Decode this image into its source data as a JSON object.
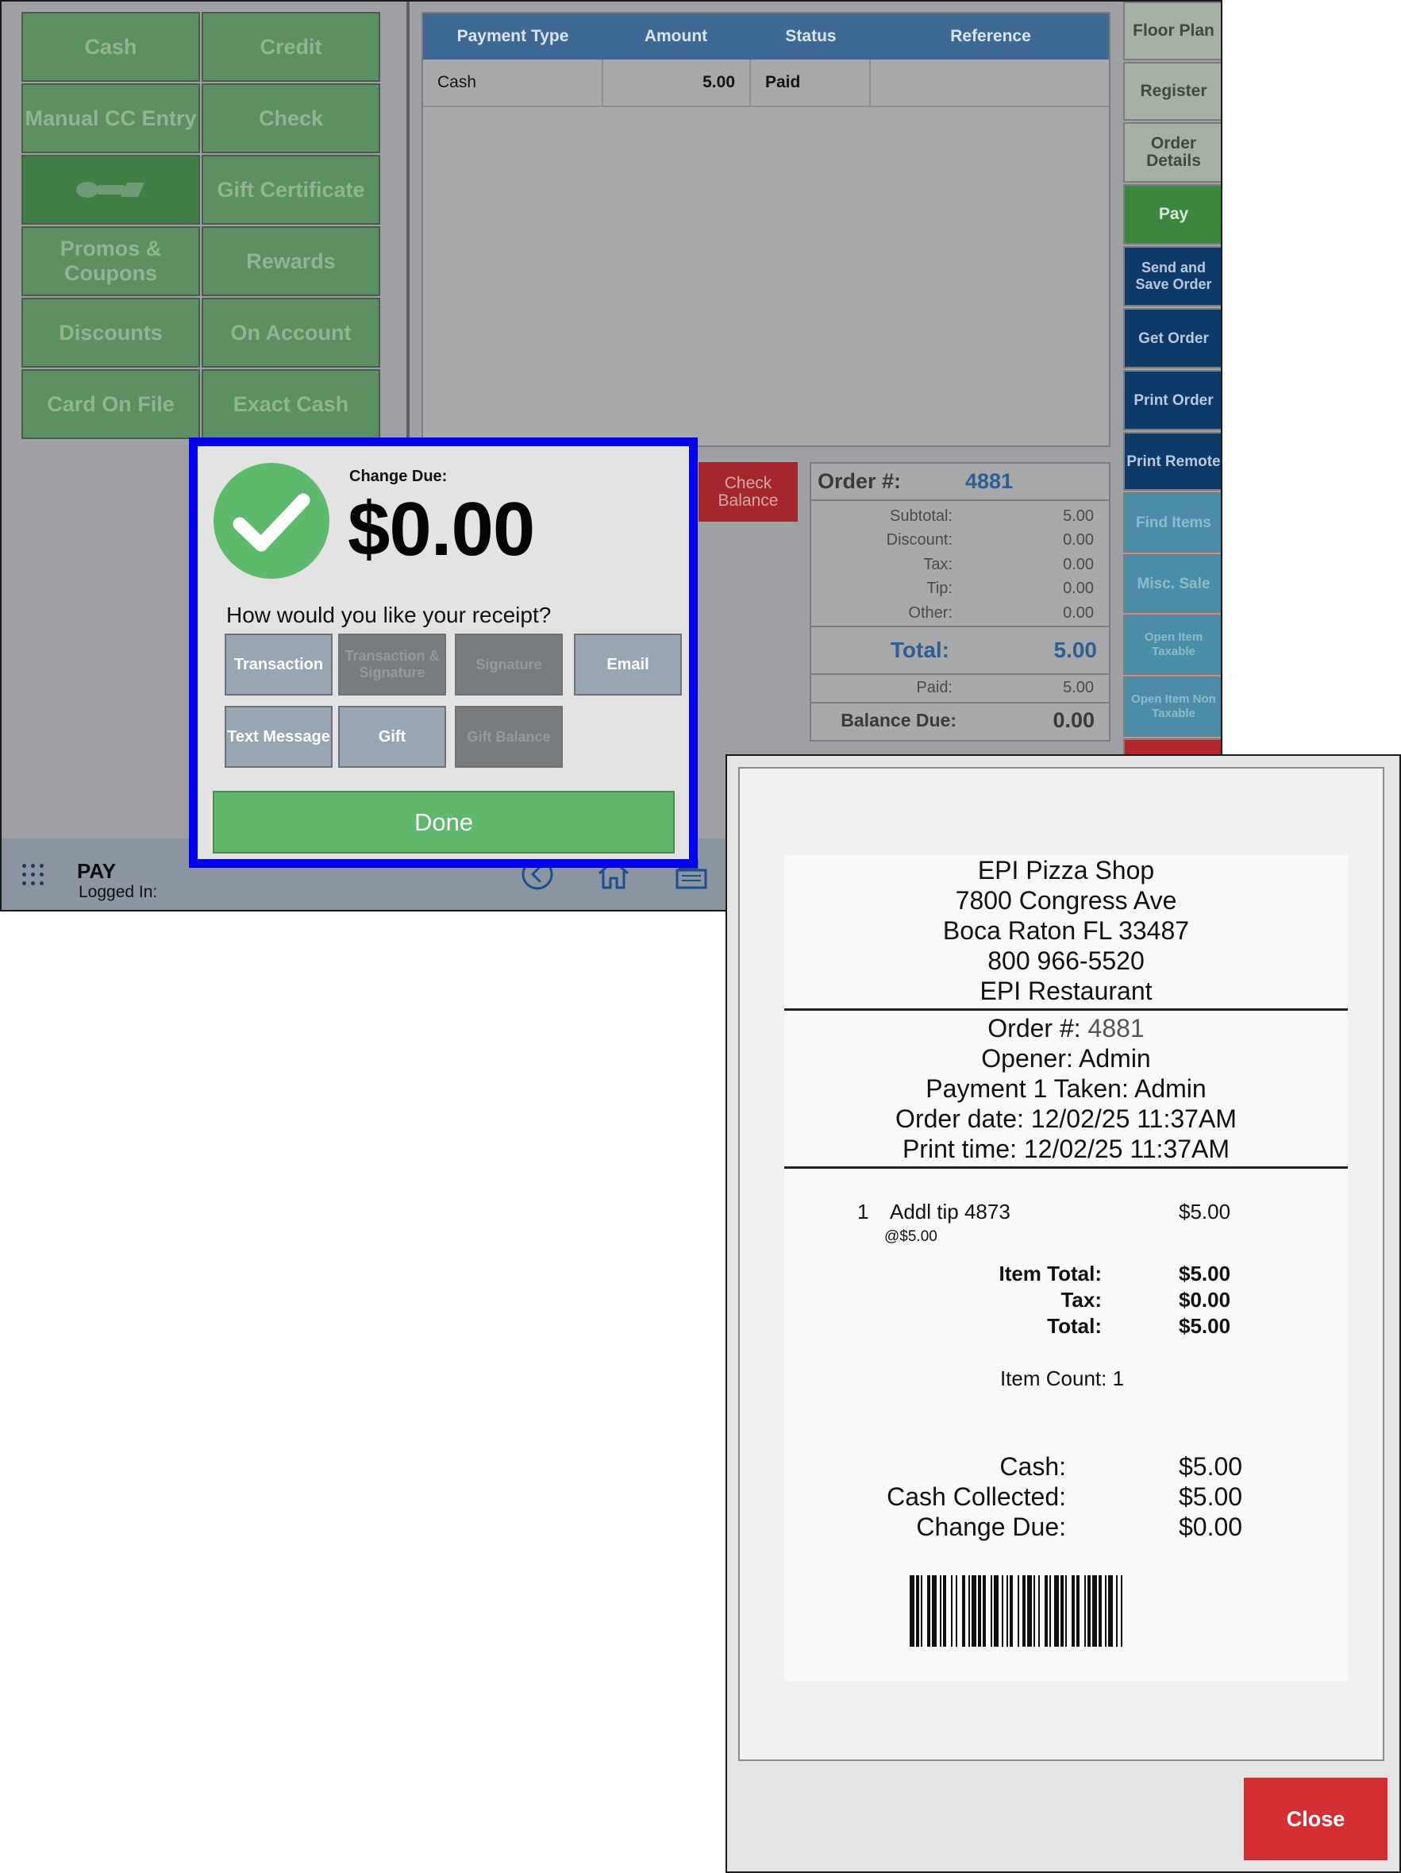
{
  "payment_methods": [
    {
      "label": "Cash",
      "active": false
    },
    {
      "label": "Credit",
      "active": false
    },
    {
      "label": "Manual CC Entry",
      "active": false
    },
    {
      "label": "Check",
      "active": false
    },
    {
      "label": "",
      "icon": "brand-logo-icon",
      "active": true
    },
    {
      "label": "Gift Certificate",
      "active": false
    },
    {
      "label": "Promos & Coupons",
      "active": false
    },
    {
      "label": "Rewards",
      "active": false
    },
    {
      "label": "Discounts",
      "active": false
    },
    {
      "label": "On Account",
      "active": false
    },
    {
      "label": "Card On File",
      "active": false
    },
    {
      "label": "Exact Cash",
      "active": false
    }
  ],
  "payments_table": {
    "headers": [
      "Payment Type",
      "Amount",
      "Status",
      "Reference"
    ],
    "rows": [
      {
        "type": "Cash",
        "amount": "5.00",
        "status": "Paid",
        "reference": ""
      }
    ]
  },
  "check_balance_label": "Check Balance",
  "order_summary": {
    "order_label": "Order #:",
    "order_number": "4881",
    "lines": [
      {
        "label": "Subtotal:",
        "value": "5.00"
      },
      {
        "label": "Discount:",
        "value": "0.00"
      },
      {
        "label": "Tax:",
        "value": "0.00"
      },
      {
        "label": "Tip:",
        "value": "0.00"
      },
      {
        "label": "Other:",
        "value": "0.00"
      }
    ],
    "total_label": "Total:",
    "total_value": "5.00",
    "paid_label": "Paid:",
    "paid_value": "5.00",
    "balance_label": "Balance Due:",
    "balance_value": "0.00"
  },
  "side_nav": [
    {
      "label": "Floor Plan",
      "style": "gray"
    },
    {
      "label": "Register",
      "style": "gray"
    },
    {
      "label": "Order Details",
      "style": "gray"
    },
    {
      "label": "Pay",
      "style": "green"
    },
    {
      "label": "Send and Save Order",
      "style": "navy"
    },
    {
      "label": "Get Order",
      "style": "navy"
    },
    {
      "label": "Print Order",
      "style": "navy"
    },
    {
      "label": "Print Remote",
      "style": "navy"
    },
    {
      "label": "Find Items",
      "style": "teal"
    },
    {
      "label": "Misc. Sale",
      "style": "teal"
    },
    {
      "label": "Open Item Taxable",
      "style": "teal"
    },
    {
      "label": "Open Item Non Taxable",
      "style": "teal"
    }
  ],
  "status_bar": {
    "title": "PAY",
    "subtitle": "Logged In:",
    "icons": [
      "apps-grid-icon",
      "back-circle-icon",
      "home-icon",
      "register-icon"
    ]
  },
  "change_dialog": {
    "change_label": "Change Due:",
    "change_amount": "$0.00",
    "receipt_question": "How would you like your receipt?",
    "receipt_options": [
      {
        "label": "Transaction",
        "enabled": true
      },
      {
        "label": "Transaction & Signature",
        "enabled": false
      },
      {
        "label": "Signature",
        "enabled": false
      },
      {
        "label": "Email",
        "enabled": true
      },
      {
        "label": "Text Message",
        "enabled": true
      },
      {
        "label": "Gift",
        "enabled": true
      },
      {
        "label": "Gift Balance",
        "enabled": false
      }
    ],
    "done_label": "Done"
  },
  "receipt": {
    "header_lines": [
      "EPI Pizza Shop",
      "7800 Congress Ave",
      "Boca Raton FL 33487",
      "800 966-5520",
      "EPI Restaurant"
    ],
    "order_label": "Order #:",
    "order_number": "4881",
    "info_lines": [
      "Opener: Admin",
      "Payment 1 Taken: Admin",
      "Order date: 12/02/25 11:37AM",
      "Print time: 12/02/25 11:37AM"
    ],
    "item": {
      "qty": "1",
      "name": "Addl tip 4873",
      "price": "$5.00",
      "unit": "@$5.00"
    },
    "summary": [
      {
        "label": "Item Total:",
        "value": "$5.00"
      },
      {
        "label": "Tax:",
        "value": "$0.00"
      },
      {
        "label": "Total:",
        "value": "$5.00"
      }
    ],
    "item_count": "Item Count: 1",
    "payments": [
      {
        "label": "Cash:",
        "value": "$5.00"
      },
      {
        "label": "Cash Collected:",
        "value": "$5.00"
      },
      {
        "label": "Change Due:",
        "value": "$0.00"
      }
    ],
    "close_label": "Close"
  },
  "colors": {
    "pay_button_bg": "#5c8f61",
    "table_header_bg": "#3e6994",
    "dialog_border": "#0000ee",
    "done_green": "#5fb86b",
    "close_red": "#d32f34",
    "navy": "#0e3a6a",
    "teal": "#4b8da6"
  }
}
